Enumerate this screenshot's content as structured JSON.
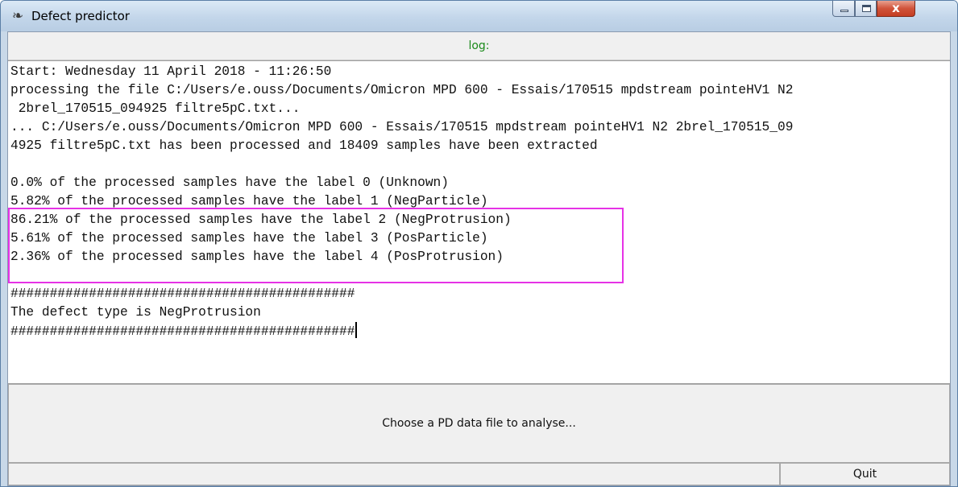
{
  "window": {
    "title": "Defect predictor",
    "app_icon": "feather-icon",
    "controls": {
      "minimize": "minimize-icon",
      "maximize": "maximize-icon",
      "close": "close-icon",
      "close_glyph": "x"
    }
  },
  "log": {
    "header": "log:",
    "header_color": "#1a8a1a",
    "lines": [
      "Start: Wednesday 11 April 2018 - 11:26:50",
      "processing the file C:/Users/e.ouss/Documents/Omicron MPD 600 - Essais/170515 mpdstream pointeHV1 N2",
      " 2brel_170515_094925 filtre5pC.txt...",
      "... C:/Users/e.ouss/Documents/Omicron MPD 600 - Essais/170515 mpdstream pointeHV1 N2 2brel_170515_09",
      "4925 filtre5pC.txt has been processed and 18409 samples have been extracted",
      "",
      "0.0% of the processed samples have the label 0 (Unknown)",
      "5.82% of the processed samples have the label 1 (NegParticle)",
      "86.21% of the processed samples have the label 2 (NegProtrusion)",
      "5.61% of the processed samples have the label 3 (PosParticle)",
      "2.36% of the processed samples have the label 4 (PosProtrusion)",
      "",
      "############################################",
      "The defect type is NegProtrusion",
      "############################################"
    ],
    "highlight_color": "#e632e6"
  },
  "buttons": {
    "choose": "Choose a PD data file to analyse...",
    "quit": "Quit"
  }
}
